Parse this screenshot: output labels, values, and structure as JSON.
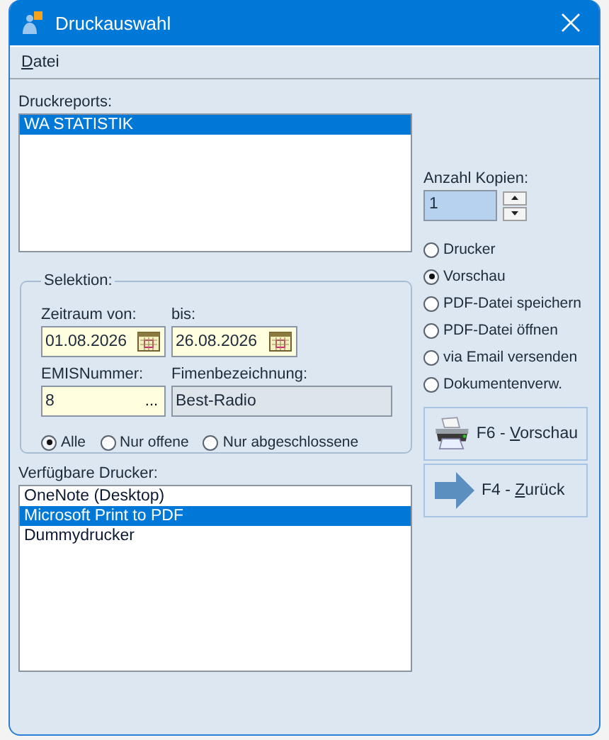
{
  "window": {
    "title": "Druckauswahl"
  },
  "menu": [
    {
      "label_parts": [
        {
          "text": "D",
          "underlined": true
        },
        {
          "text": "atei",
          "underlined": false
        }
      ]
    }
  ],
  "reports": {
    "label": "Druckreports:",
    "items": [
      {
        "label": "WA STATISTIK",
        "selected": true
      }
    ]
  },
  "selection": {
    "title": "Selektion:",
    "from_label": "Zeitraum von:",
    "from": "01.08.2026",
    "to_label": "bis:",
    "to": "26.08.2026",
    "number_label": "EMISNummer:",
    "number": "8",
    "lookup": "...",
    "company_label": "Fimenbezeichnung:",
    "company": "Best-Radio",
    "filters": [
      {
        "label": "Alle",
        "selected": true
      },
      {
        "label": "Nur offene",
        "selected": false
      },
      {
        "label": "Nur abgeschlossene",
        "selected": false
      }
    ]
  },
  "printers": {
    "label": "Verfügbare Drucker:",
    "items": [
      {
        "label": "OneNote (Desktop)",
        "selected": false
      },
      {
        "label": "Microsoft Print to PDF",
        "selected": true
      },
      {
        "label": "Dummydrucker",
        "selected": false
      }
    ]
  },
  "copies": {
    "label": "Anzahl Kopien:",
    "value": "1"
  },
  "outputs": [
    {
      "label": "Drucker",
      "selected": false
    },
    {
      "label": "Vorschau",
      "selected": true
    },
    {
      "label": "PDF-Datei speichern",
      "selected": false
    },
    {
      "label": "PDF-Datei öffnen",
      "selected": false
    },
    {
      "label": "via Email versenden",
      "selected": false
    },
    {
      "label": "Dokumentenverw.",
      "selected": false
    }
  ],
  "buttons": [
    {
      "kind": "preview",
      "label_parts": [
        {
          "text": "F6 - ",
          "underlined": false
        },
        {
          "text": "V",
          "underlined": true
        },
        {
          "text": "orschau",
          "underlined": false
        }
      ]
    },
    {
      "kind": "back",
      "label_parts": [
        {
          "text": "F4 - ",
          "underlined": false
        },
        {
          "text": "Z",
          "underlined": true
        },
        {
          "text": "urück",
          "underlined": false
        }
      ]
    }
  ]
}
